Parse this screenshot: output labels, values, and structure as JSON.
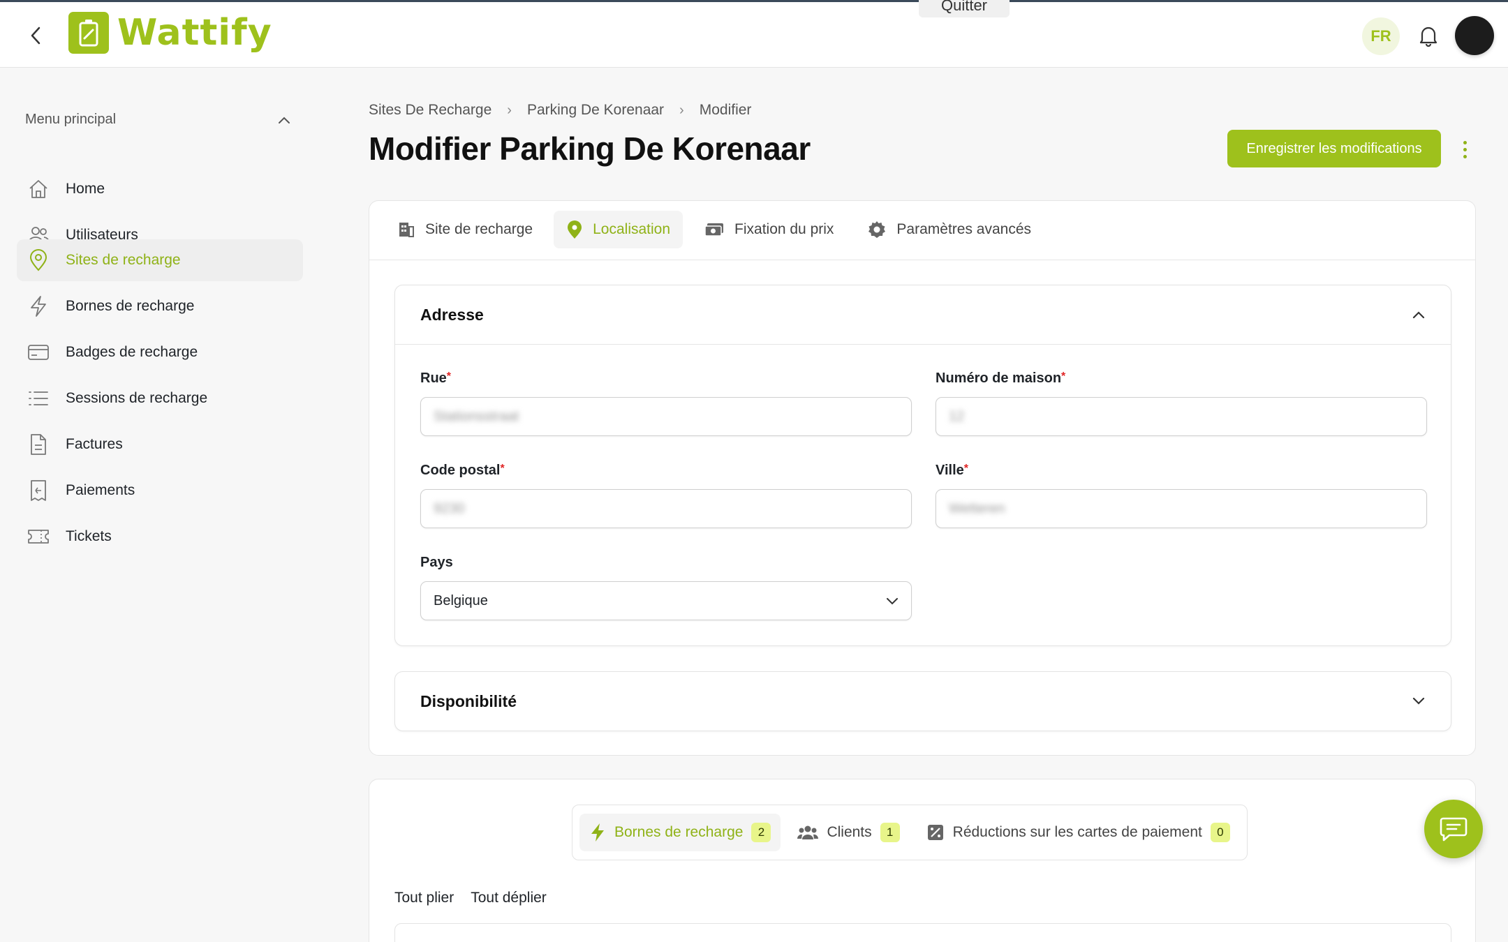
{
  "header": {
    "logo_text": "Wattify",
    "quit_label": "Quitter",
    "language": "FR",
    "brand_color": "#9ec11c"
  },
  "sidebar": {
    "menu_title": "Menu principal",
    "items": [
      {
        "label": "Home",
        "icon": "home-icon",
        "active": false
      },
      {
        "label": "Utilisateurs",
        "icon": "users-icon",
        "active": false
      },
      {
        "label": "Sites de recharge",
        "icon": "location-pin-icon",
        "active": true
      },
      {
        "label": "Bornes de recharge",
        "icon": "lightning-icon",
        "active": false
      },
      {
        "label": "Badges de recharge",
        "icon": "card-icon",
        "active": false
      },
      {
        "label": "Sessions de recharge",
        "icon": "list-icon",
        "active": false
      },
      {
        "label": "Factures",
        "icon": "document-icon",
        "active": false
      },
      {
        "label": "Paiements",
        "icon": "receipt-icon",
        "active": false
      },
      {
        "label": "Tickets",
        "icon": "ticket-icon",
        "active": false
      }
    ]
  },
  "breadcrumb": [
    "Sites De Recharge",
    "Parking De Korenaar",
    "Modifier"
  ],
  "page": {
    "title": "Modifier Parking De Korenaar",
    "save_label": "Enregistrer les modifications"
  },
  "tabs": [
    {
      "label": "Site de recharge",
      "icon": "building-icon",
      "active": false
    },
    {
      "label": "Localisation",
      "icon": "location-pin-icon",
      "active": true
    },
    {
      "label": "Fixation du prix",
      "icon": "money-icon",
      "active": false
    },
    {
      "label": "Paramètres avancés",
      "icon": "gear-icon",
      "active": false
    }
  ],
  "address": {
    "title": "Adresse",
    "rue_label": "Rue",
    "rue_value": "Stationsstraat",
    "house_label": "Numéro de maison",
    "house_value": "12",
    "postal_label": "Code postal",
    "postal_value": "9230",
    "city_label": "Ville",
    "city_value": "Wetteren",
    "country_label": "Pays",
    "country_value": "Belgique"
  },
  "availability": {
    "title": "Disponibilité"
  },
  "subtabs": [
    {
      "label": "Bornes de recharge",
      "count": "2",
      "icon": "lightning-icon",
      "active": true
    },
    {
      "label": "Clients",
      "count": "1",
      "icon": "users-icon",
      "active": false
    },
    {
      "label": "Réductions sur les cartes de paiement",
      "count": "0",
      "icon": "discount-icon",
      "active": false
    }
  ],
  "fold": {
    "collapse_all": "Tout plier",
    "expand_all": "Tout déplier"
  }
}
